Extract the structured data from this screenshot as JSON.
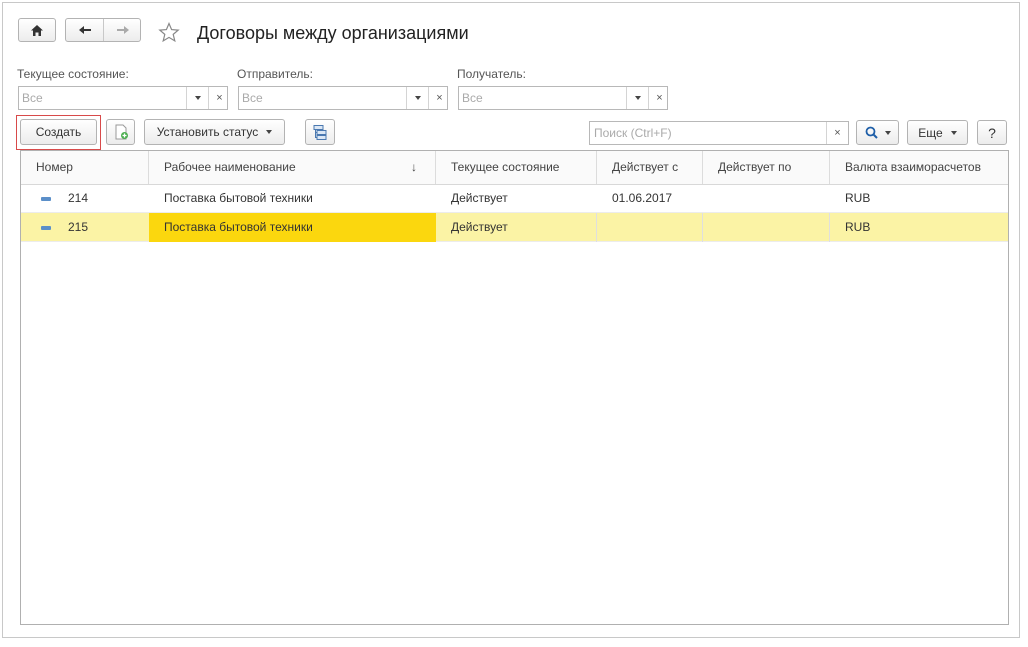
{
  "window": {
    "title": "Договоры между организациями"
  },
  "nav": {
    "home_icon": "home-icon",
    "back_icon": "arrow-left-icon",
    "forward_icon": "arrow-right-icon",
    "favorite_icon": "star-outline-icon"
  },
  "filters": [
    {
      "label": "Текущее состояние:",
      "placeholder": "Все"
    },
    {
      "label": "Отправитель:",
      "placeholder": "Все"
    },
    {
      "label": "Получатель:",
      "placeholder": "Все"
    }
  ],
  "toolbar": {
    "create_label": "Создать",
    "set_status_label": "Установить статус",
    "search_placeholder": "Поиск (Ctrl+F)",
    "more_label": "Еще",
    "help_label": "?"
  },
  "table": {
    "columns": [
      "Номер",
      "Рабочее наименование",
      "Текущее состояние",
      "Действует с",
      "Действует по",
      "Валюта взаиморасчетов"
    ],
    "sort_indicator": "↓",
    "rows": [
      {
        "number": "214",
        "name": "Поставка бытовой техники",
        "state": "Действует",
        "from": "01.06.2017",
        "to": "",
        "currency": "RUB"
      },
      {
        "number": "215",
        "name": "Поставка бытовой техники",
        "state": "Действует",
        "from": "",
        "to": "",
        "currency": "RUB"
      }
    ]
  },
  "clear_glyph": "×"
}
